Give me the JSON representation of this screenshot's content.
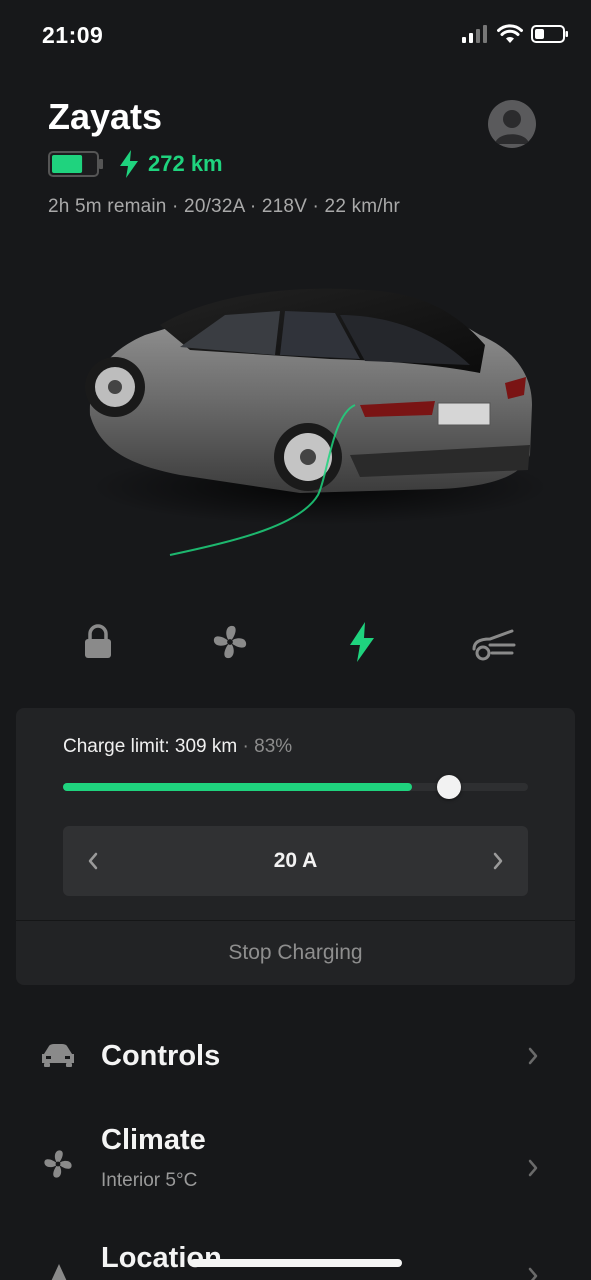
{
  "status_bar": {
    "time": "21:09",
    "icons": [
      "signal-icon",
      "wifi-icon",
      "battery-icon"
    ]
  },
  "vehicle": {
    "name": "Zayats",
    "range": "272 km",
    "charge_details": "2h 5m remain · 20/32A · 218V · 22 km/hr",
    "battery_level": 0.7
  },
  "quick_actions": [
    {
      "name": "lock",
      "icon": "lock-icon"
    },
    {
      "name": "climate",
      "icon": "fan-icon"
    },
    {
      "name": "charge",
      "icon": "bolt-icon",
      "active": true
    },
    {
      "name": "frunk",
      "icon": "frunk-icon"
    }
  ],
  "charging": {
    "limit_label": "Charge limit: 309 km",
    "limit_percent": "· 83%",
    "current_charge_fraction": 0.75,
    "limit_fraction": 0.83,
    "amps": "20 A",
    "stop_label": "Stop Charging"
  },
  "menu": {
    "controls": {
      "title": "Controls"
    },
    "climate": {
      "title": "Climate",
      "subtitle": "Interior 5°C"
    },
    "location": {
      "title": "Location"
    }
  },
  "colors": {
    "accent": "#1fd37e",
    "background": "#17181a",
    "card": "#222325"
  }
}
